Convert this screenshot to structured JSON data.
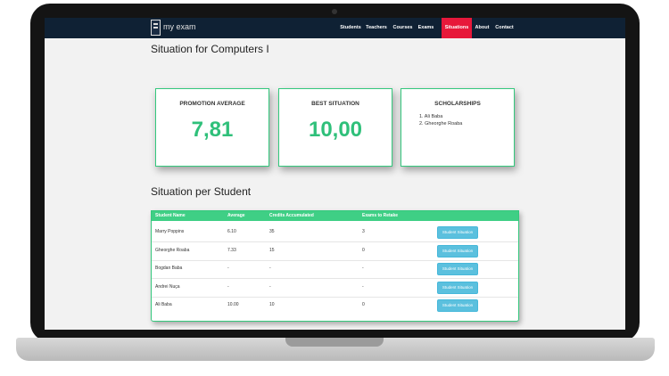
{
  "nav": {
    "logo": "my exam",
    "items": [
      {
        "label": "Students",
        "active": false
      },
      {
        "label": "Teachers",
        "active": false
      },
      {
        "label": "Courses",
        "active": false
      },
      {
        "label": "Exams",
        "active": false
      },
      {
        "label": "Situations",
        "active": true
      },
      {
        "label": "About",
        "active": false
      },
      {
        "label": "Contact",
        "active": false
      }
    ]
  },
  "page": {
    "title": "Situation for Computers I",
    "section_title": "Situation per Student"
  },
  "cards": {
    "promotion": {
      "title": "PROMOTION AVERAGE",
      "value": "7,81"
    },
    "best": {
      "title": "BEST SITUATION",
      "value": "10,00"
    },
    "scholarships": {
      "title": "SCHOLARSHIPS",
      "items": [
        "1. Ali Baba",
        "2. Gheorghe Roaba"
      ]
    }
  },
  "table": {
    "headers": [
      "Student Name",
      "Average",
      "Credits Accumulated",
      "Exams to Retake"
    ],
    "rows": [
      {
        "name": "Marry Poppins",
        "average": "6.10",
        "credits": "35",
        "retake": "3",
        "button": "Student Situation"
      },
      {
        "name": "Gheorghe Roaba",
        "average": "7.33",
        "credits": "15",
        "retake": "0",
        "button": "Student Situation"
      },
      {
        "name": "Bogdan Baba",
        "average": "-",
        "credits": "-",
        "retake": "-",
        "button": "Student Situation"
      },
      {
        "name": "Andrei Nuça",
        "average": "-",
        "credits": "-",
        "retake": "-",
        "button": "Student Situation"
      },
      {
        "name": "Ali Baba",
        "average": "10.00",
        "credits": "10",
        "retake": "0",
        "button": "Student Situation"
      }
    ]
  },
  "colors": {
    "accent": "#3fcf85",
    "nav_bg": "#0f2134",
    "active_nav": "#e7183a",
    "button": "#5bc0de"
  }
}
